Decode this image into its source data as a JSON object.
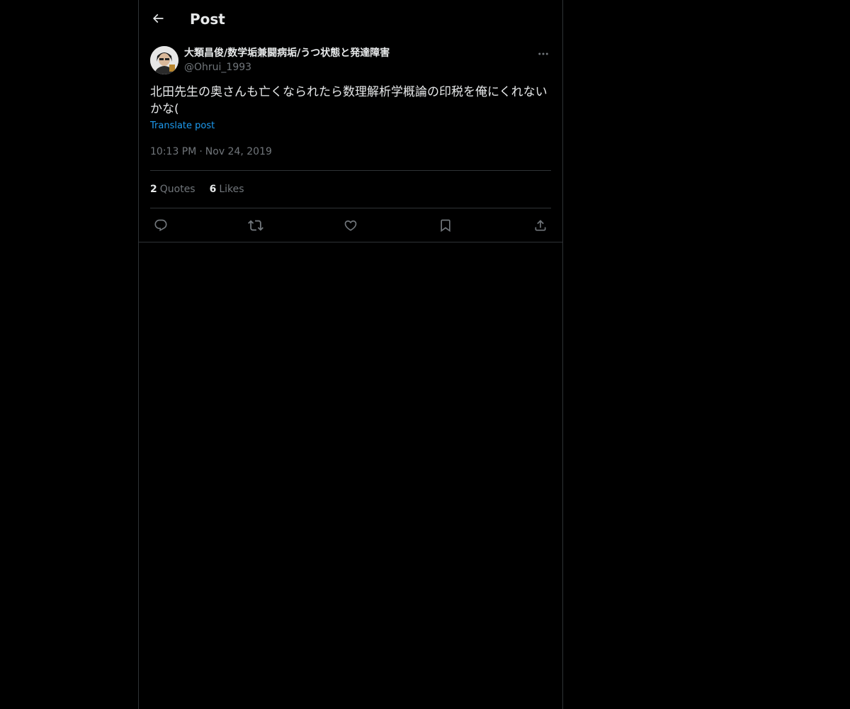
{
  "header": {
    "title": "Post",
    "back_icon": "arrow-left-icon"
  },
  "post": {
    "author": {
      "display_name": "大類昌俊/数学垢兼闘病垢/うつ状態と発達障害",
      "handle": "@Ohrui_1993",
      "avatar_icon": "avatar"
    },
    "text": "北田先生の奥さんも亡くなられたら数理解析学概論の印税を俺にくれないかな(",
    "translate_label": "Translate post",
    "time": "10:13 PM",
    "separator": "·",
    "date": "Nov 24, 2019",
    "stats": {
      "quotes_count": "2",
      "quotes_label": "Quotes",
      "likes_count": "6",
      "likes_label": "Likes"
    },
    "actions": [
      "reply-icon",
      "repost-icon",
      "like-icon",
      "bookmark-icon",
      "share-icon"
    ]
  },
  "colors": {
    "background": "#000000",
    "text": "#e7e9ea",
    "secondary": "#71767b",
    "link": "#1d9bf0",
    "border": "#2f3336"
  }
}
